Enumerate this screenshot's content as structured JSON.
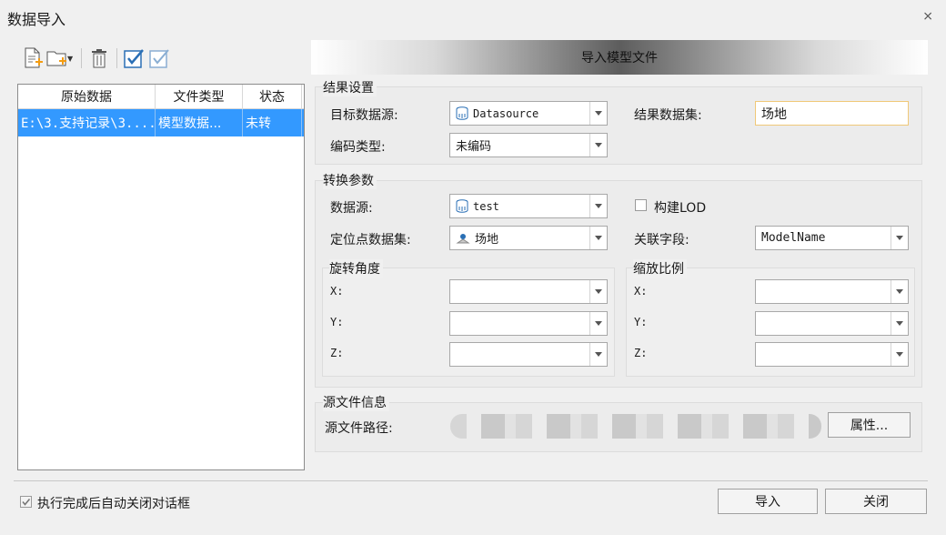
{
  "window": {
    "title": "数据导入"
  },
  "file_table": {
    "headers": [
      "原始数据",
      "文件类型",
      "状态"
    ],
    "rows": [
      {
        "source": "E:\\3.支持记录\\3....",
        "type": "模型数据...",
        "status": "未转"
      }
    ]
  },
  "banner": "导入模型文件",
  "result_settings": {
    "title": "结果设置",
    "target_ds_label": "目标数据源:",
    "target_ds_value": "Datasource",
    "result_dataset_label": "结果数据集:",
    "result_dataset_value": "场地",
    "encoding_label": "编码类型:",
    "encoding_value": "未编码"
  },
  "conversion": {
    "title": "转换参数",
    "datasource_label": "数据源:",
    "datasource_value": "test",
    "build_lod_label": "构建LOD",
    "anchor_label": "定位点数据集:",
    "anchor_value": "场地",
    "link_field_label": "关联字段:",
    "link_field_value": "ModelName",
    "rotation_title": "旋转角度",
    "scale_title": "缩放比例",
    "x": "X:",
    "y": "Y:",
    "z": "Z:"
  },
  "source_info": {
    "title": "源文件信息",
    "path_label": "源文件路径:",
    "properties_button": "属性..."
  },
  "footer": {
    "auto_close_label": "执行完成后自动关闭对话框",
    "import_button": "导入",
    "close_button": "关闭"
  },
  "colors": {
    "selection": "#3399ff",
    "textbox_border": "#f0c878"
  }
}
